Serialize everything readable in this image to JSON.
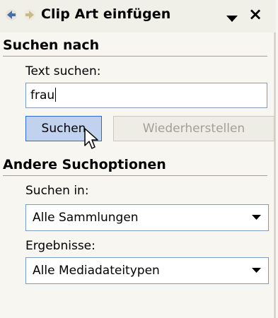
{
  "panel": {
    "title": "Clip Art einfügen",
    "back_icon": "back-arrow-icon",
    "forward_icon": "forward-arrow-icon",
    "menu_icon": "dropdown-triangle-icon",
    "close_icon": "close-icon",
    "close_glyph": "×"
  },
  "search_section": {
    "heading": "Suchen nach",
    "text_label": "Text suchen:",
    "text_value": "frau",
    "search_button": "Suchen",
    "reset_button": "Wiederherstellen"
  },
  "options_section": {
    "heading": "Andere Suchoptionen",
    "search_in_label": "Suchen in:",
    "search_in_value": "Alle Sammlungen",
    "results_label": "Ergebnisse:",
    "results_value": "Alle Mediadateitypen"
  },
  "colors": {
    "pane_bg": "#f7f6f1",
    "accent_border": "#316ac5",
    "button_hover_bg": "#c1d2ee",
    "disabled_text": "#a19f96",
    "nav_arrow_back": "#4a6fa5",
    "nav_arrow_forward": "#c9b98a"
  }
}
